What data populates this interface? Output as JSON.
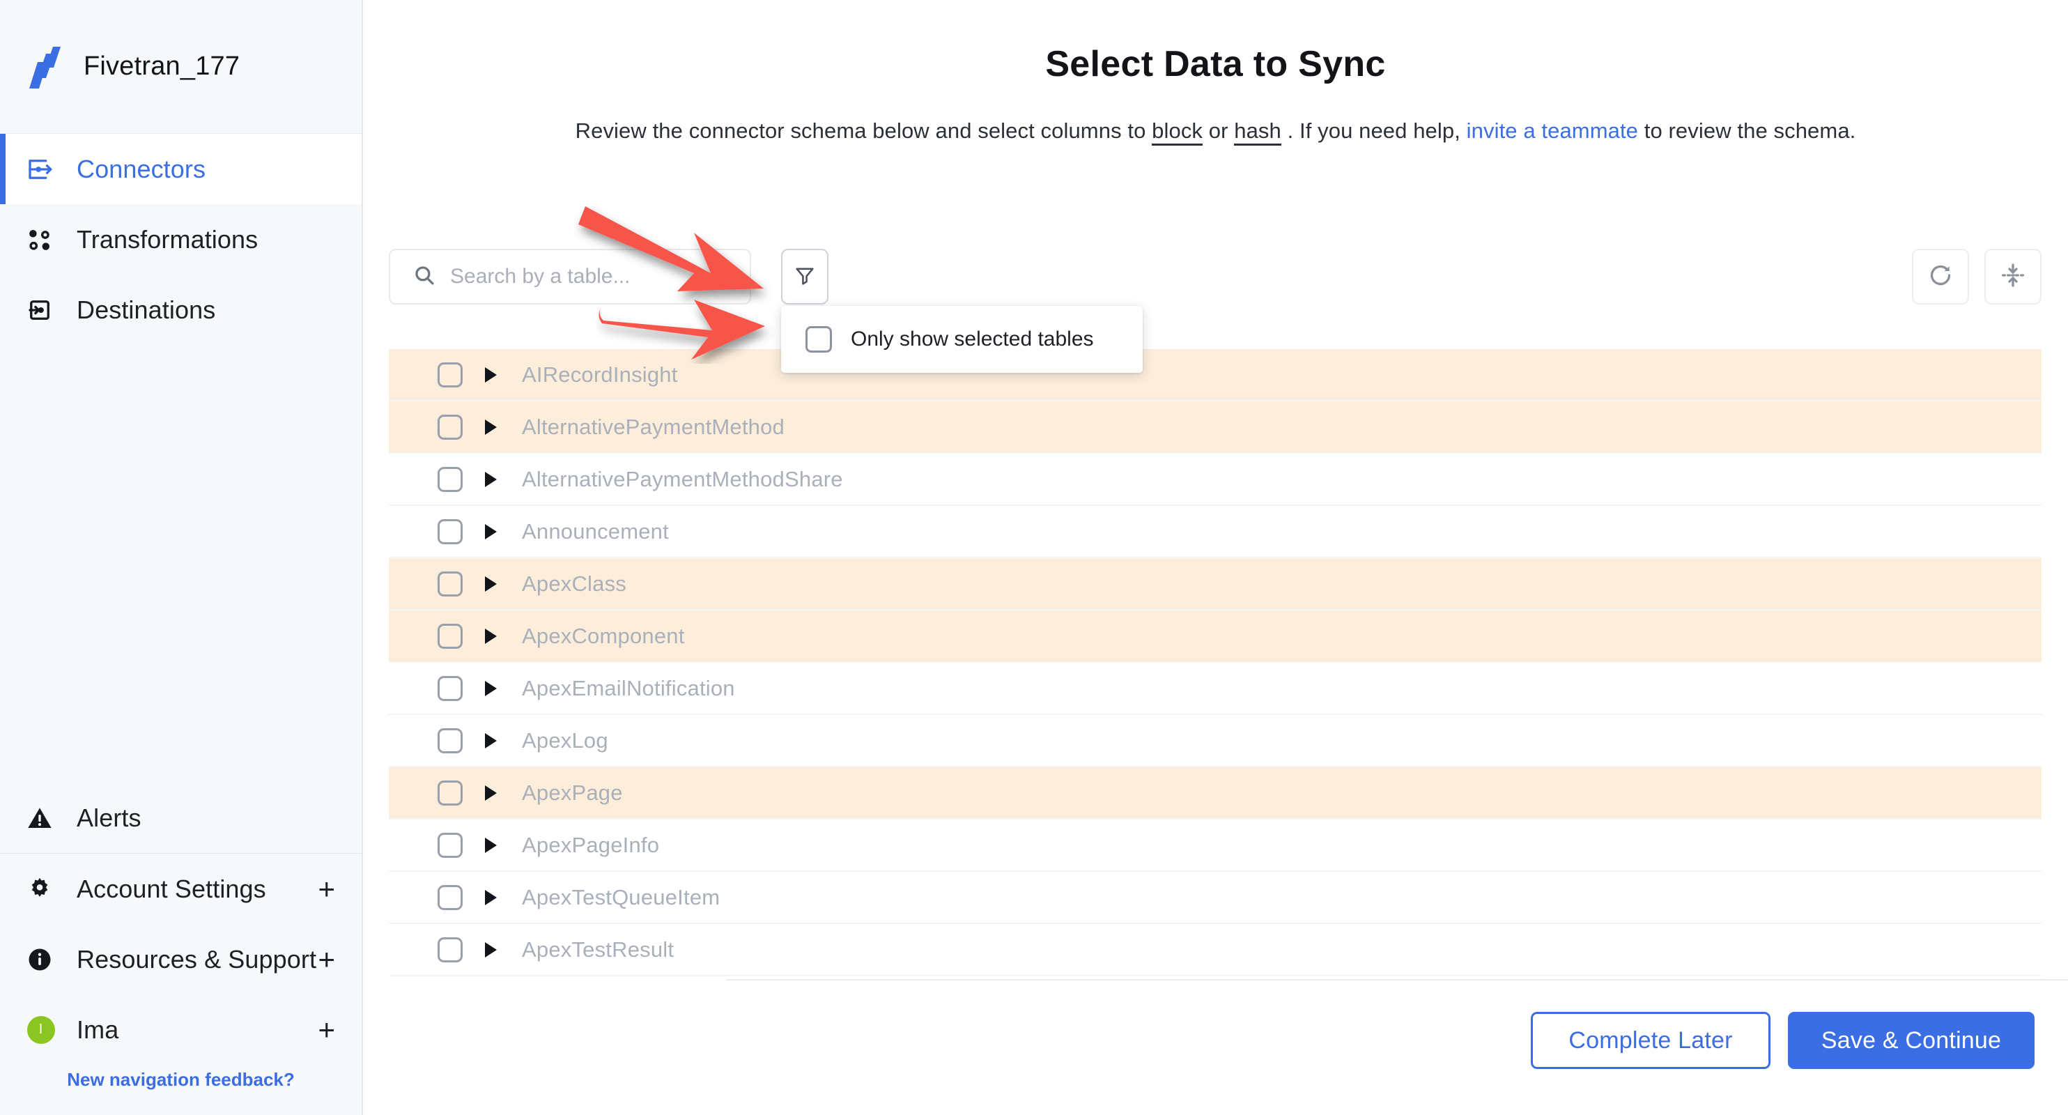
{
  "sidebar": {
    "brand": {
      "name": "Fivetran_177",
      "logo_icon": "fivetran-logo-icon"
    },
    "main_items": [
      {
        "label": "Connectors",
        "icon": "connectors-icon",
        "active": true
      },
      {
        "label": "Transformations",
        "icon": "transformations-icon",
        "active": false
      },
      {
        "label": "Destinations",
        "icon": "destinations-icon",
        "active": false
      }
    ],
    "bottom_items": [
      {
        "label": "Alerts",
        "icon": "alert-triangle-icon",
        "plus": false,
        "avatar": null
      },
      {
        "label": "Account Settings",
        "icon": "gear-icon",
        "plus": true,
        "avatar": null
      },
      {
        "label": "Resources & Support",
        "icon": "info-circle-icon",
        "plus": true,
        "avatar": null
      },
      {
        "label": "Ima",
        "icon": "avatar",
        "plus": true,
        "avatar": "I"
      }
    ],
    "feedback_link": "New navigation feedback?"
  },
  "header": {
    "title": "Select Data to Sync",
    "subtitle_parts": {
      "p1": "Review the connector schema below and select columns to ",
      "tip1": "block",
      "p2": " or ",
      "tip2": "hash",
      "p3": " . If you need help, ",
      "link": "invite a teammate",
      "p4": " to review the schema."
    }
  },
  "toolbar": {
    "search_placeholder": "Search by a table...",
    "search_value": "",
    "search_icon": "search-icon",
    "filter_icon": "filter-funnel-icon",
    "refresh_icon": "refresh-icon",
    "collapse_icon": "collapse-all-icon"
  },
  "filter_menu": {
    "open": true,
    "option_label": "Only show selected tables",
    "option_checked": false
  },
  "tables": [
    {
      "name": "AIRecordInsight",
      "highlighted": true,
      "checked": false
    },
    {
      "name": "AlternativePaymentMethod",
      "highlighted": true,
      "checked": false
    },
    {
      "name": "AlternativePaymentMethodShare",
      "highlighted": false,
      "checked": false
    },
    {
      "name": "Announcement",
      "highlighted": false,
      "checked": false
    },
    {
      "name": "ApexClass",
      "highlighted": true,
      "checked": false
    },
    {
      "name": "ApexComponent",
      "highlighted": true,
      "checked": false
    },
    {
      "name": "ApexEmailNotification",
      "highlighted": false,
      "checked": false
    },
    {
      "name": "ApexLog",
      "highlighted": false,
      "checked": false
    },
    {
      "name": "ApexPage",
      "highlighted": true,
      "checked": false
    },
    {
      "name": "ApexPageInfo",
      "highlighted": false,
      "checked": false
    },
    {
      "name": "ApexTestQueueItem",
      "highlighted": false,
      "checked": false
    },
    {
      "name": "ApexTestResult",
      "highlighted": false,
      "checked": false
    }
  ],
  "footer": {
    "complete_later": "Complete Later",
    "save_continue": "Save & Continue"
  },
  "colors": {
    "accent": "#3b6ee3",
    "highlight_row": "#fdeddb",
    "annotation_arrow": "#f7544a",
    "avatar_green": "#8bc522"
  },
  "annotations": [
    {
      "name": "arrow-to-filter-button",
      "direction": "down-right"
    },
    {
      "name": "arrow-to-only-show-selected-checkbox",
      "direction": "right"
    }
  ]
}
